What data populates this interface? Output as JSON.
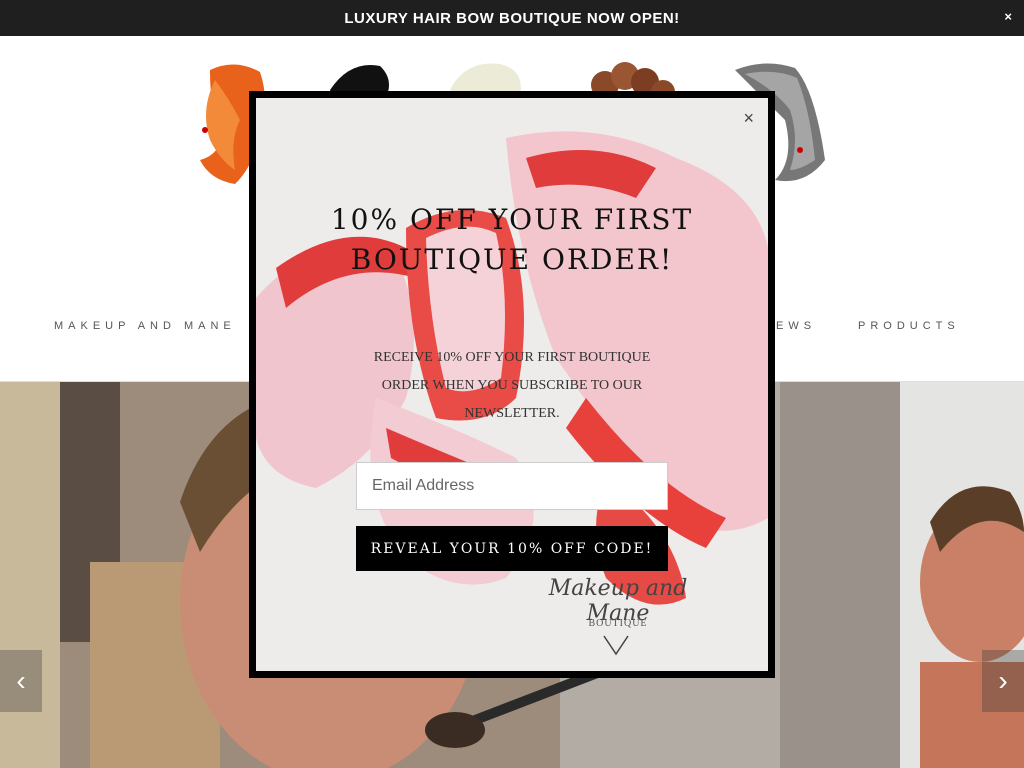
{
  "announcement": {
    "text": "LUXURY HAIR BOW BOUTIQUE NOW OPEN!",
    "close_label": "×"
  },
  "nav": {
    "items": [
      {
        "label": "MAKEUP AND MANE"
      },
      {
        "label": "IEWS"
      },
      {
        "label": "PRODUCTS"
      }
    ]
  },
  "popup": {
    "close_label": "×",
    "heading": "10% OFF YOUR FIRST BOUTIQUE ORDER!",
    "subtext": "RECEIVE 10% OFF YOUR FIRST BOUTIQUE ORDER WHEN YOU SUBSCRIBE TO OUR NEWSLETTER.",
    "email_placeholder": "Email Address",
    "button_label": "REVEAL YOUR 10% OFF CODE!",
    "brand_name": "Makeup and Mane",
    "brand_sub": "BOUTIQUE"
  },
  "slideshow": {
    "prev_label": "‹",
    "next_label": "›"
  },
  "colors": {
    "announcement_bg": "#1f1f1f",
    "popup_border": "#000000",
    "button_bg": "#000000",
    "bow_red": "#e8403a",
    "bow_pink": "#f2c6cc"
  },
  "icons": {
    "close": "close-icon",
    "prev": "chevron-left-icon",
    "next": "chevron-right-icon"
  }
}
